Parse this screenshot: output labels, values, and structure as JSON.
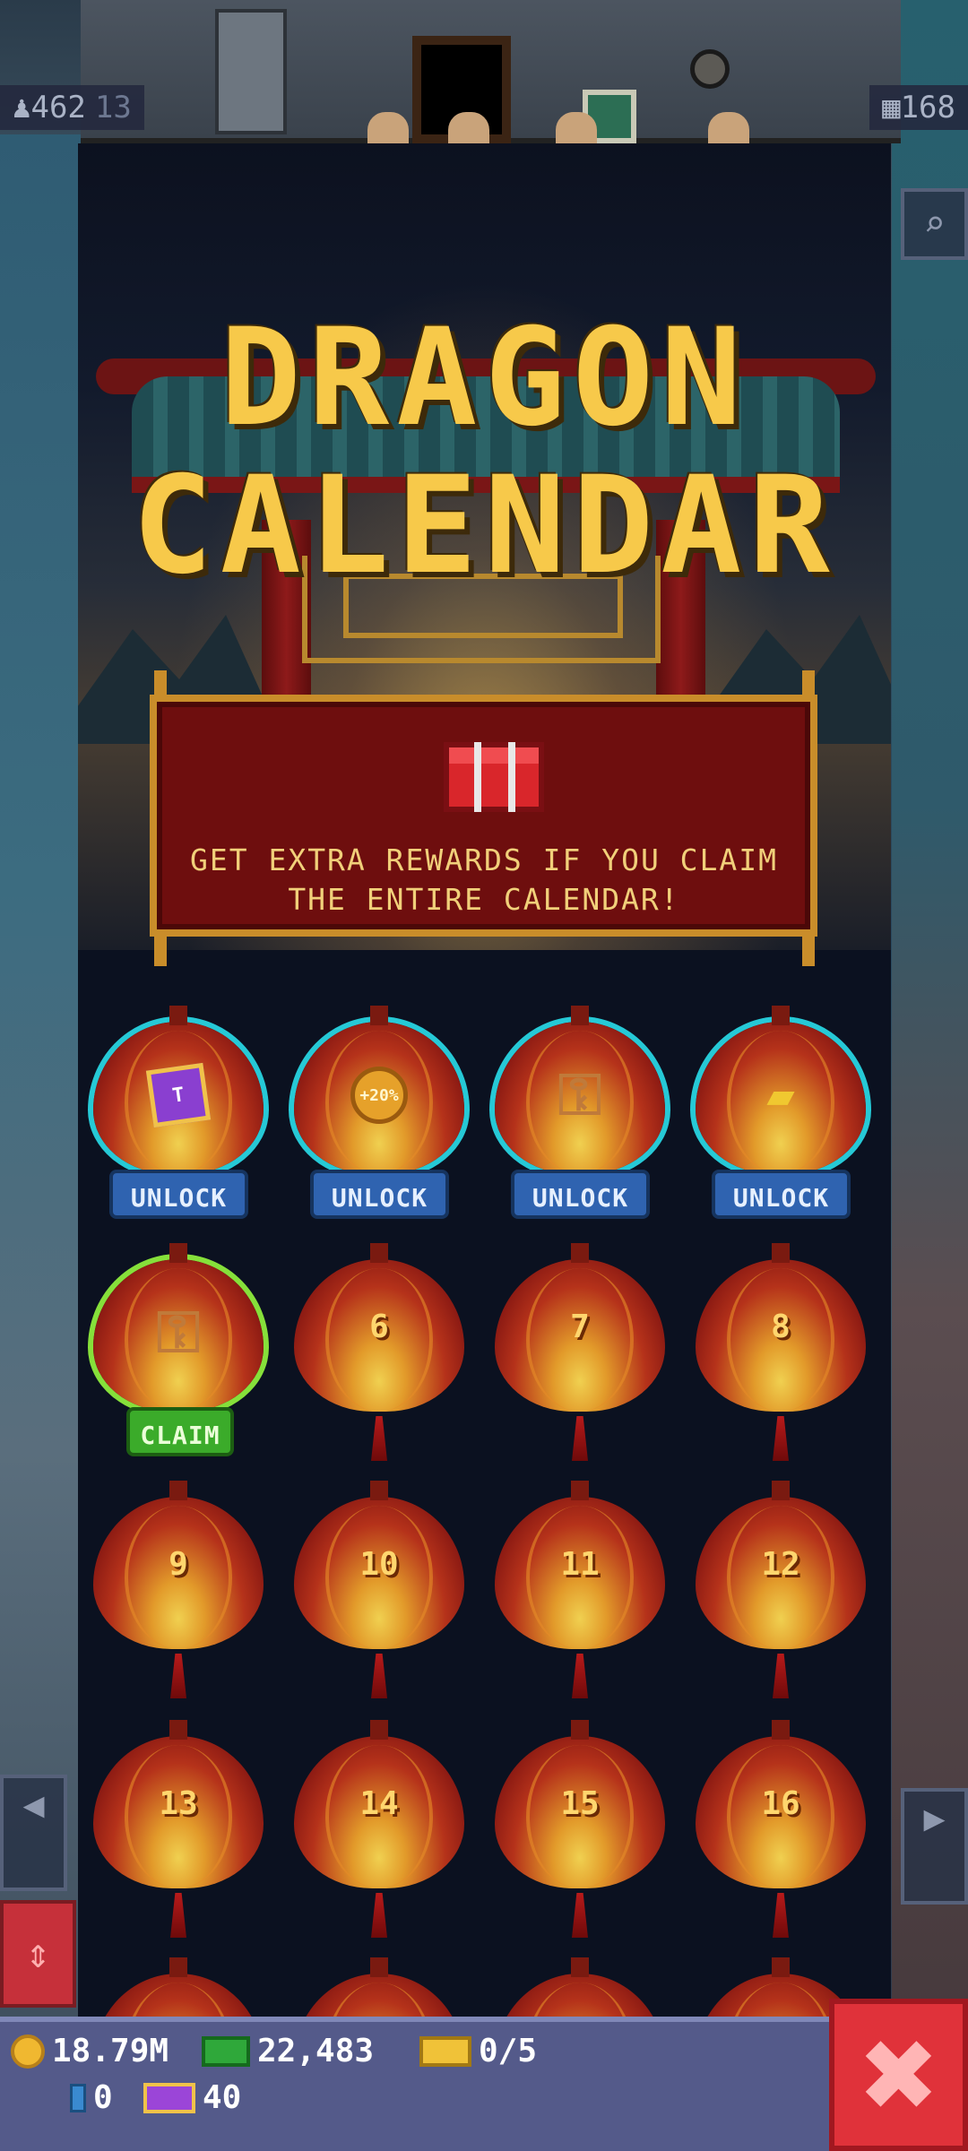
{
  "hud": {
    "population": "462",
    "population_secondary": "13",
    "floors": "168"
  },
  "header": {
    "title_line1": "DRAGON",
    "title_line2": "CALENDAR",
    "banner_text": "GET EXTRA REWARDS IF YOU CLAIM THE ENTIRE CALENDAR!"
  },
  "calendar": {
    "days": [
      {
        "state": "locked",
        "reward_icon": "ticket-icon",
        "reward_text": "T",
        "button": "UNLOCK"
      },
      {
        "state": "locked",
        "reward_icon": "coin-bonus-icon",
        "reward_text": "+20%",
        "button": "UNLOCK"
      },
      {
        "state": "locked",
        "reward_icon": "key-icon",
        "reward_text": "",
        "button": "UNLOCK"
      },
      {
        "state": "locked",
        "reward_icon": "gold-bars-icon",
        "reward_text": "",
        "button": "UNLOCK"
      },
      {
        "state": "claimable",
        "reward_icon": "key-icon",
        "reward_text": "",
        "button": "CLAIM"
      },
      {
        "state": "future",
        "number": "6"
      },
      {
        "state": "future",
        "number": "7"
      },
      {
        "state": "future",
        "number": "8"
      },
      {
        "state": "future",
        "number": "9"
      },
      {
        "state": "future",
        "number": "10"
      },
      {
        "state": "future",
        "number": "11"
      },
      {
        "state": "future",
        "number": "12"
      },
      {
        "state": "future",
        "number": "13"
      },
      {
        "state": "future",
        "number": "14"
      },
      {
        "state": "future",
        "number": "15"
      },
      {
        "state": "future",
        "number": "16"
      }
    ]
  },
  "resources": {
    "coins": "18.79M",
    "bux": "22,483",
    "golden_tickets": "0/5",
    "gems": "0",
    "tickets": "40"
  },
  "colors": {
    "title": "#f7c94a",
    "unlock_button": "#2f63b0",
    "claim_button": "#3bab2a",
    "close_button": "#e0323a",
    "bottom_bar": "#545a8a"
  }
}
